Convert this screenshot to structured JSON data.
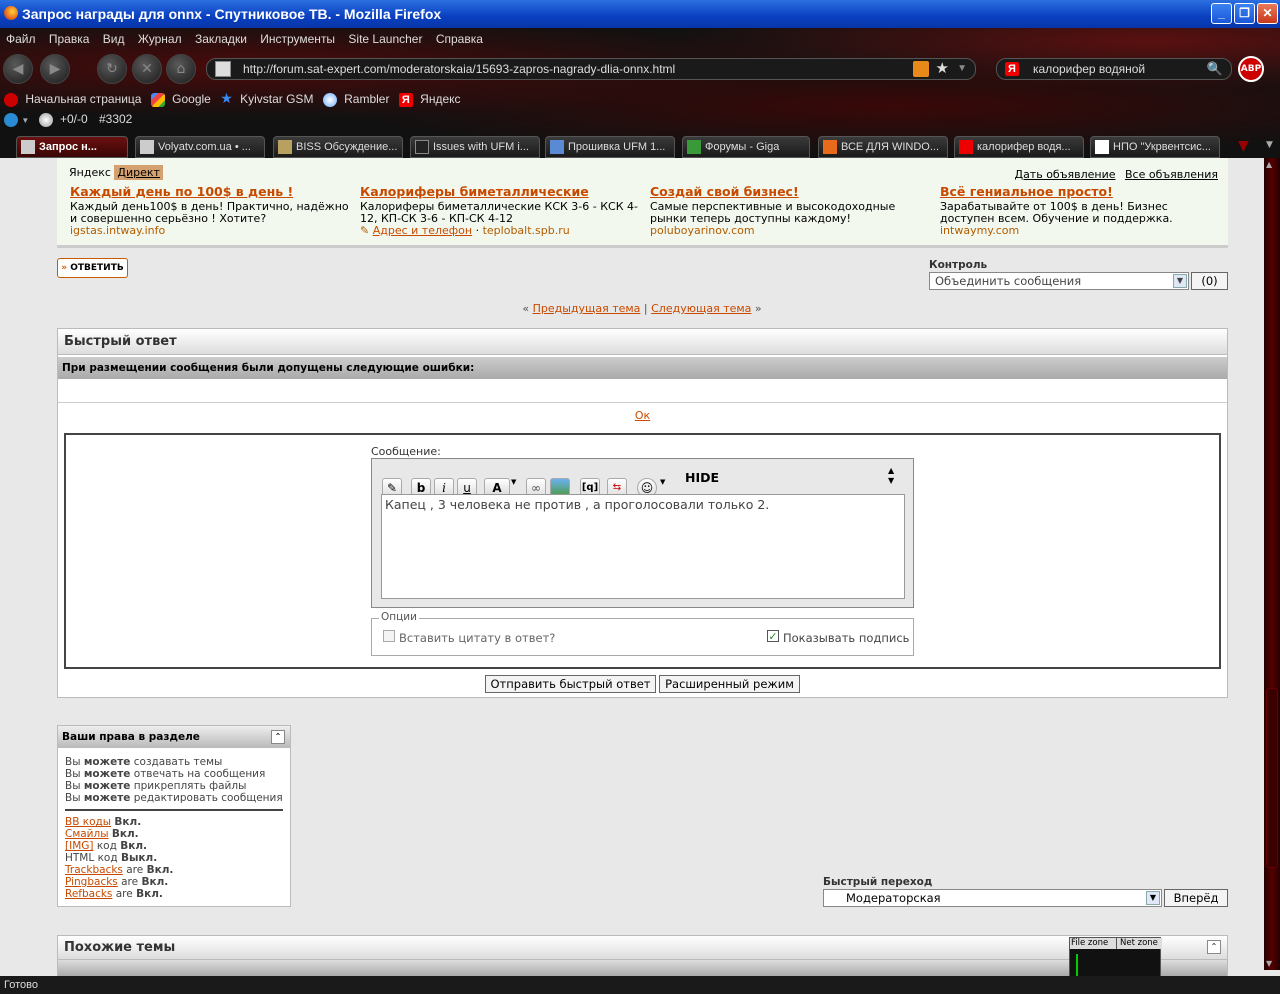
{
  "window": {
    "title": "Запрос награды для onnx - Спутниковое ТВ. - Mozilla Firefox"
  },
  "menu": [
    "Файл",
    "Правка",
    "Вид",
    "Журнал",
    "Закладки",
    "Инструменты",
    "Site Launcher",
    "Справка"
  ],
  "nav": {
    "url": "http://forum.sat-expert.com/moderatorskaia/15693-zapros-nagrady-dlia-onnx.html",
    "search_value": "калорифер водяной",
    "abp_label": "ABP"
  },
  "bookmarks": [
    "Начальная страница",
    "Google",
    "Kyivstar GSM",
    "Rambler",
    "Яндекс"
  ],
  "addon": {
    "counter": "+0/-0",
    "id": "#3302"
  },
  "tabs": [
    "Запрос н...",
    "Volyatv.com.ua • ...",
    "BISS Обсуждение...",
    "Issues with UFM i...",
    "Прошивка UFM 1...",
    "Форумы - Giga",
    "ВСЕ ДЛЯ WINDO...",
    "калорифер водя...",
    "НПО \"Укрвентсис..."
  ],
  "ads": {
    "brand_yandex": "Яндекс",
    "brand_direct": "Директ",
    "give_ad": "Дать объявление",
    "all_ads": "Все объявления",
    "items": [
      {
        "title": "Каждый день по 100$ в день !",
        "text": "Каждый день100$ в день! Практично, надёжно и совершенно серьёзно ! Хотите?",
        "url": "igstas.intway.info"
      },
      {
        "title": "Калориферы биметаллические",
        "text": "Калориферы биметаллические КСК 3-6 - КСК 4-12, КП-СК 3-6 - КП-СК 4-12",
        "url": "teplobalt.spb.ru",
        "address": "Адрес и телефон"
      },
      {
        "title": "Создай свой бизнес!",
        "text": "Самые перспективные и высокодоходные рынки теперь доступны каждому!",
        "url": "poluboyarinov.com"
      },
      {
        "title": "Всё гениальное просто!",
        "text": "Зарабатывайте от 100$ в день! Бизнес доступен всем. Обучение и поддержка.",
        "url": "intwaymy.com"
      }
    ]
  },
  "reply_button": "ОТВЕТИТЬ",
  "control": {
    "label": "Контроль",
    "select_value": "Объединить сообщения",
    "count": "(0)"
  },
  "thread_nav": {
    "prev": "Предыдущая тема",
    "next": "Следующая тема"
  },
  "quick_reply": {
    "title": "Быстрый ответ",
    "errors_header": "При размещении сообщения были допущены следующие ошибки:",
    "ok": "Ок",
    "message_label": "Сообщение:",
    "hide_label": "HIDE",
    "message_text": "Капец , 3 человека не против , а проголосовали только 2.",
    "options_label": "Опции",
    "quote_label": "Вставить цитату в ответ?",
    "signature_label": "Показывать подпись",
    "quote_checked": false,
    "signature_checked": true,
    "submit": "Отправить быстрый ответ",
    "advanced": "Расширенный режим"
  },
  "rights": {
    "title": "Ваши права в разделе",
    "perms": [
      {
        "pre": "Вы",
        "bold": "можете",
        "post": "создавать темы"
      },
      {
        "pre": "Вы",
        "bold": "можете",
        "post": "отвечать на сообщения"
      },
      {
        "pre": "Вы",
        "bold": "можете",
        "post": "прикреплять файлы"
      },
      {
        "pre": "Вы",
        "bold": "можете",
        "post": "редактировать сообщения"
      }
    ],
    "codes": [
      {
        "name": "BB коды",
        "mid": "",
        "state": "Вкл."
      },
      {
        "name": "Смайлы",
        "mid": "",
        "state": "Вкл."
      },
      {
        "name": "[IMG]",
        "mid": "код",
        "state": "Вкл."
      },
      {
        "name": "HTML",
        "mid": "код",
        "state": "Выкл."
      },
      {
        "name": "Trackbacks",
        "mid": "are",
        "state": "Вкл."
      },
      {
        "name": "Pingbacks",
        "mid": "are",
        "state": "Вкл."
      },
      {
        "name": "Refbacks",
        "mid": "are",
        "state": "Вкл."
      }
    ]
  },
  "jump": {
    "label": "Быстрый переход",
    "value": "Модераторская",
    "go": "Вперёд"
  },
  "similar": {
    "title": "Похожие темы"
  },
  "zones": {
    "file": "File zone",
    "net": "Net zone"
  },
  "status": "Готово"
}
